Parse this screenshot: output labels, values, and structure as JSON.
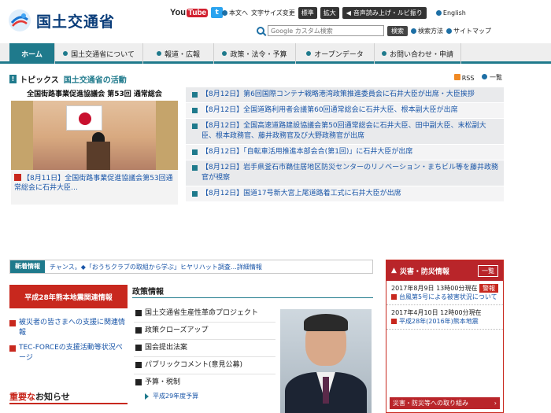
{
  "header": {
    "logo_text": "国土交通省",
    "youtube_label": "You",
    "youtube_tube": "Tube",
    "twitter_label": "t",
    "skip_to_main": "本文へ",
    "font_size_label": "文字サイズ変更",
    "font_standard": "標準",
    "font_large": "拡大",
    "voice_label": "音声読み上げ・ルビ振り",
    "english_label": "English",
    "search_placeholder": "Google カスタム検索",
    "search_button": "検索",
    "search_method": "検索方法",
    "sitemap": "サイトマップ"
  },
  "nav": {
    "items": [
      "ホーム",
      "国土交通省について",
      "報道・広報",
      "政策・法令・予算",
      "オープンデータ",
      "お問い合わせ・申請"
    ]
  },
  "topics": {
    "mark": "!",
    "title": "トピックス",
    "subtitle": "国土交通省の活動",
    "rss": "RSS",
    "list": "一覧",
    "feature_banner": "全国街路事業促進協議会 第53回 通常総会",
    "feature_date": "【8月11日】",
    "feature_caption": "全国街路事業促進協議会第53回通常総会に石井大臣…",
    "items": [
      "【8月12日】第6回国際コンテナ戦略港湾政策推進委員会に石井大臣が出席・大臣挨拶",
      "【8月12日】全国道路利用者会議第60回通常総会に石井大臣、根本副大臣が出席",
      "【8月12日】全国高速道路建設協議会第50回通常総会に石井大臣、田中副大臣、末松副大臣、根本政務官、藤井政務官及び大野政務官が出席",
      "【8月12日】「自転車活用推進本部会合(第1回)」に石井大臣が出席",
      "【8月12日】岩手県釜石市鵜住居地区防災センターのリノベーション・まちビル等を藤井政務官が視察",
      "【8月12日】国道17号新大宮上尾道路着工式に石井大臣が出席"
    ]
  },
  "ticker": {
    "label": "新着情報",
    "text": "チャンス。◆「おうちクラブの取組から学ぶ」ヒヤリハット調査…詳細情報"
  },
  "kumamoto": {
    "banner": "平成28年熊本地震関連情報",
    "links": [
      "被災者の皆さまへの支援に関連情報",
      "TEC-FORCEの支援活動等状況ページ"
    ]
  },
  "notice": {
    "prefix": "重要な",
    "rest": "お知らせ"
  },
  "policy": {
    "heading": "政策情報",
    "items": [
      "国土交通省生産性革命プロジェクト",
      "政策クローズアップ",
      "国会提出法案",
      "パブリックコメント(意見公募)",
      "予算・税制"
    ],
    "sub": "平成29年度予算"
  },
  "disaster": {
    "title": "災害・防災情報",
    "list_button": "一覧",
    "items": [
      {
        "date": "2017年8月9日 13時00分現在",
        "badge": "警報",
        "link": "台風第5号による被害状況について"
      },
      {
        "date": "2017年4月10日 12時00分現在",
        "badge": "",
        "link": "平成28年(2016年)熊本地震"
      }
    ],
    "footer": "災害・防災等への取り組み"
  },
  "colors": {
    "accent": "#1f7a8c",
    "alert": "#c8281e",
    "link": "#1a56a8"
  }
}
